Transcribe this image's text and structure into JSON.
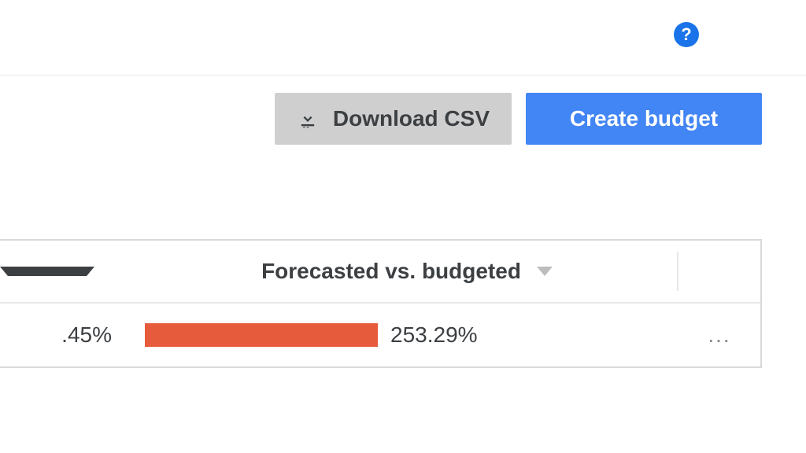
{
  "toolbar": {
    "download_label": "Download CSV",
    "create_label": "Create budget"
  },
  "table": {
    "columns": {
      "prev_partial": "",
      "forecasted": "Forecasted vs. budgeted"
    },
    "rows": [
      {
        "prev_value": ".45%",
        "forecasted_pct": "253.29%",
        "bar_color": "#e75b3d",
        "actions": "..."
      }
    ]
  },
  "help": "?"
}
